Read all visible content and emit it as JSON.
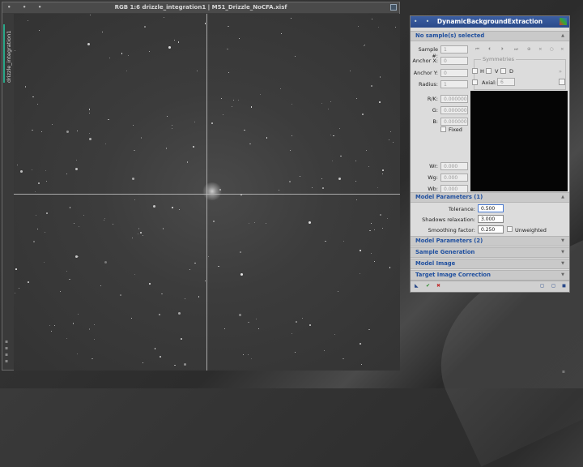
{
  "image_window": {
    "title": "RGB 1:6 drizzle_integration1 | M51_Drizzle_NoCFA.xisf",
    "title_dots": "• • •",
    "side_tab": "drizzle_integration1"
  },
  "dbe": {
    "title": "DynamicBackgroundExtraction",
    "title_dots": "• •",
    "sample_header": "No sample(s) selected",
    "labels": {
      "sample": "Sample #:",
      "anchor_x": "Anchor X:",
      "anchor_y": "Anchor Y:",
      "radius": "Radius:",
      "rk": "R/K:",
      "g": "G:",
      "b": "B:",
      "fixed": "Fixed",
      "wr": "Wr:",
      "wg": "Wg:",
      "wb": "Wb:",
      "symmetries": "Symmetries",
      "h": "H",
      "v": "V",
      "d": "D",
      "axial": "Axial:"
    },
    "values": {
      "sample": "1",
      "anchor_x": "0",
      "anchor_y": "0",
      "radius": "1",
      "rk": "0.000000",
      "g": "0.000000",
      "b": "0.000000",
      "wr": "0.000",
      "wg": "0.000",
      "wb": "0.000",
      "axial": "6"
    },
    "sections": {
      "model_params_1": "Model Parameters (1)",
      "model_params_2": "Model Parameters (2)",
      "sample_generation": "Sample Generation",
      "model_image": "Model Image",
      "target_correction": "Target Image Correction"
    },
    "params": {
      "tolerance_label": "Tolerance:",
      "tolerance": "0.500",
      "shadows_label": "Shadows relaxation:",
      "shadows": "3.000",
      "smoothing_label": "Smoothing factor:",
      "smoothing": "0.250",
      "unweighted_label": "Unweighted"
    }
  }
}
